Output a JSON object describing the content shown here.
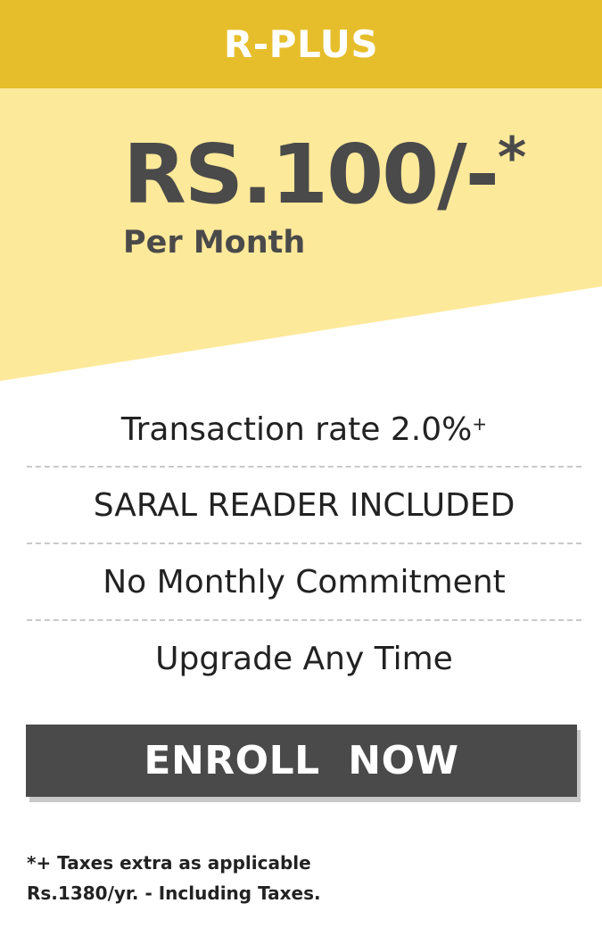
{
  "plan": {
    "name": "R-PLUS",
    "price": "RS.100/-",
    "price_mark": "*",
    "period": "Per Month"
  },
  "features": [
    {
      "text": "Transaction rate 2.0%",
      "sup": "+"
    },
    {
      "text": "SARAL READER INCLUDED"
    },
    {
      "text": "No Monthly Commitment"
    },
    {
      "text": "Upgrade Any Time"
    }
  ],
  "cta": {
    "label": "ENROLL  NOW"
  },
  "footnotes": [
    "*+ Taxes extra as applicable",
    "Rs.1380/yr. - Including Taxes."
  ],
  "colors": {
    "header": "#e6be2b",
    "price_band": "#fde99a",
    "button": "#4a4a4a",
    "text_dark": "#4a4a4a"
  }
}
